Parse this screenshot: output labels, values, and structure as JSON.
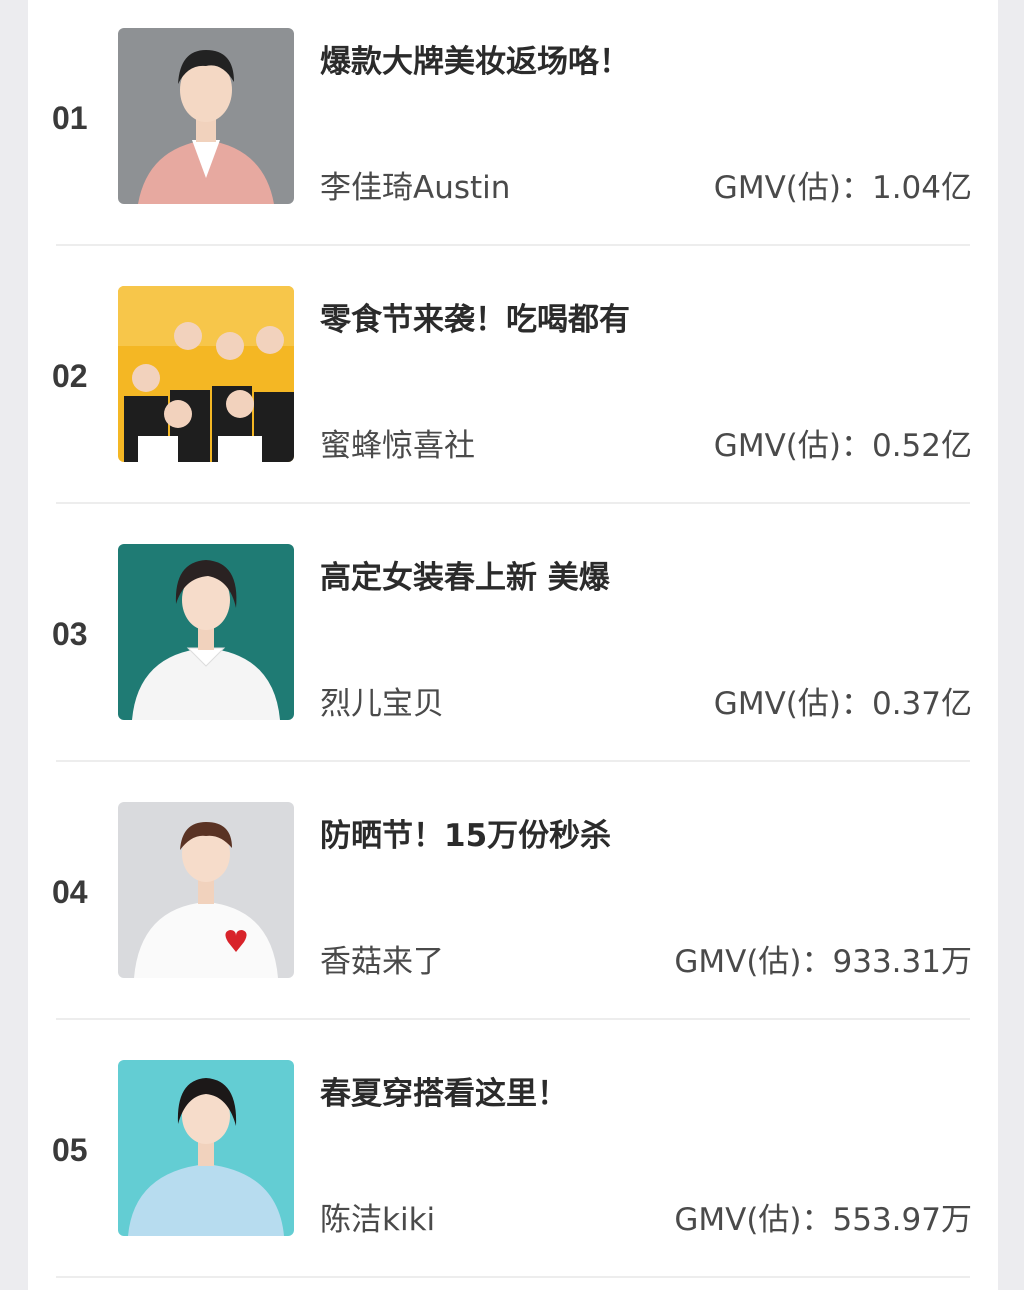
{
  "items": [
    {
      "rank": "01",
      "title": "爆款大牌美妆返场咯！",
      "streamer": "李佳琦Austin",
      "gmv_label": "GMV(估)：",
      "gmv": "1.04亿",
      "bg": "#8e9194"
    },
    {
      "rank": "02",
      "title": "零食节来袭！吃喝都有",
      "streamer": "蜜蜂惊喜社",
      "gmv_label": "GMV(估)：",
      "gmv": "0.52亿",
      "bg": "#f4b724"
    },
    {
      "rank": "03",
      "title": "高定女装春上新 美爆",
      "streamer": "烈儿宝贝",
      "gmv_label": "GMV(估)：",
      "gmv": "0.37亿",
      "bg": "#1f7b74"
    },
    {
      "rank": "04",
      "title": "防晒节！15万份秒杀",
      "streamer": "香菇来了",
      "gmv_label": "GMV(估)：",
      "gmv": "933.31万",
      "bg": "#d9dadd"
    },
    {
      "rank": "05",
      "title": "春夏穿搭看这里！",
      "streamer": "陈洁kiki",
      "gmv_label": "GMV(估)：",
      "gmv": "553.97万",
      "bg": "#63cdd3"
    }
  ]
}
